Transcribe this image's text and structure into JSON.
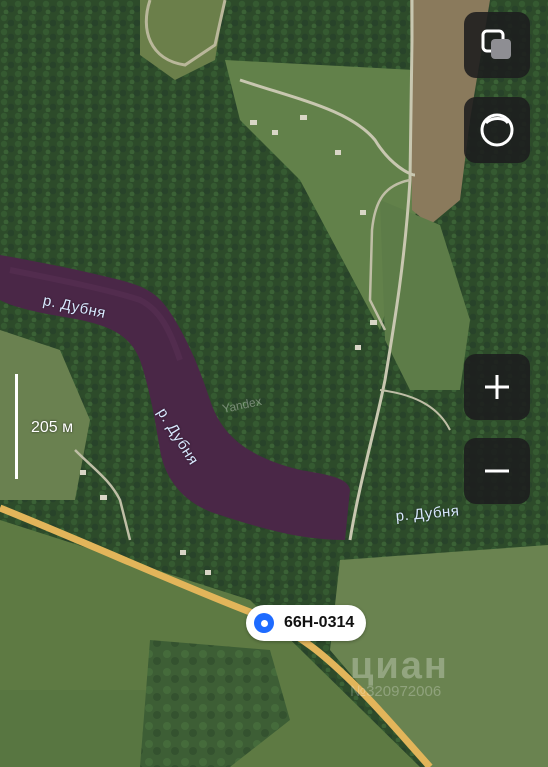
{
  "map": {
    "rivers": [
      {
        "label": "р. Дубня"
      },
      {
        "label": "р. Дубня"
      },
      {
        "label": "р. Дубня"
      }
    ],
    "scale": {
      "label": "205 м"
    },
    "road_badge": {
      "label": "66Н-0314"
    },
    "provider_mark": "Yandex",
    "watermark": {
      "brand": "циан",
      "sub": "№320972006"
    }
  },
  "controls": {
    "layers_icon": "layers-icon",
    "location_icon": "compass-icon",
    "zoom_in_icon": "plus-icon",
    "zoom_out_icon": "minus-icon"
  },
  "colors": {
    "water": "#4a2747",
    "road": "#e2b55a",
    "forest": "#2d4b2a",
    "field": "#5f7a44",
    "control_bg": "#1c1c1e",
    "badge_dot": "#1e6bff"
  }
}
